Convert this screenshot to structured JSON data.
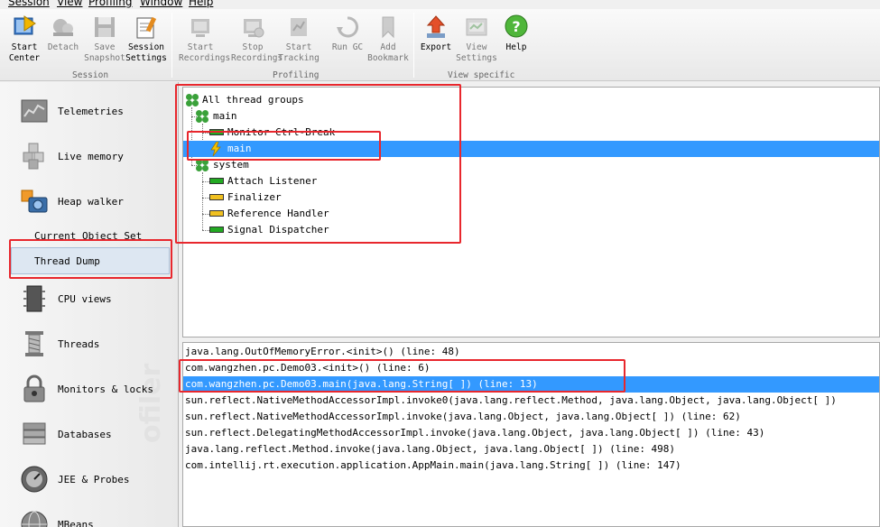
{
  "menu": [
    "Session",
    "View",
    "Profiling",
    "Window",
    "Help"
  ],
  "toolbar": {
    "buttons": [
      {
        "label": "Start\nCenter",
        "icon": "start-center-icon",
        "enabled": true
      },
      {
        "label": "Detach",
        "icon": "detach-icon",
        "enabled": false
      },
      {
        "label": "Save\nSnapshot",
        "icon": "save-snapshot-icon",
        "enabled": false
      },
      {
        "label": "Session\nSettings",
        "icon": "session-settings-icon",
        "enabled": true
      },
      {
        "label": "Start\nRecordings",
        "icon": "start-recordings-icon",
        "enabled": false
      },
      {
        "label": "Stop\nRecordings",
        "icon": "stop-recordings-icon",
        "enabled": false
      },
      {
        "label": "Start\nTracking",
        "icon": "start-tracking-icon",
        "enabled": false
      },
      {
        "label": "Run GC",
        "icon": "run-gc-icon",
        "enabled": false
      },
      {
        "label": "Add\nBookmark",
        "icon": "add-bookmark-icon",
        "enabled": false
      },
      {
        "label": "Export",
        "icon": "export-icon",
        "enabled": true
      },
      {
        "label": "View\nSettings",
        "icon": "view-settings-icon",
        "enabled": false
      },
      {
        "label": "Help",
        "icon": "help-icon",
        "enabled": true
      }
    ],
    "groups": [
      "Session",
      "Profiling",
      "View specific"
    ]
  },
  "sidebar": {
    "items": [
      {
        "label": "Telemetries",
        "icon": "telemetries-icon"
      },
      {
        "label": "Live memory",
        "icon": "live-memory-icon"
      },
      {
        "label": "Heap walker",
        "icon": "heap-walker-icon"
      },
      {
        "label": "CPU views",
        "icon": "cpu-views-icon"
      },
      {
        "label": "Threads",
        "icon": "threads-icon"
      },
      {
        "label": "Monitors & locks",
        "icon": "monitors-locks-icon"
      },
      {
        "label": "Databases",
        "icon": "databases-icon"
      },
      {
        "label": "JEE & Probes",
        "icon": "jee-probes-icon"
      },
      {
        "label": "MBeans",
        "icon": "mbeans-icon"
      }
    ],
    "sub_items": [
      "Current Object Set",
      "Thread Dump"
    ],
    "watermark": "ofiler"
  },
  "thread_tree": {
    "root": "All thread groups",
    "groups": [
      {
        "name": "main",
        "threads": [
          {
            "name": "Monitor Ctrl-Break",
            "state_color": "#22aa22"
          },
          {
            "name": "main",
            "state_color": "#f0c020",
            "selected": true
          }
        ]
      },
      {
        "name": "system",
        "threads": [
          {
            "name": "Attach Listener",
            "state_color": "#22aa22"
          },
          {
            "name": "Finalizer",
            "state_color": "#f0c020"
          },
          {
            "name": "Reference Handler",
            "state_color": "#f0c020"
          },
          {
            "name": "Signal Dispatcher",
            "state_color": "#22aa22"
          }
        ]
      }
    ]
  },
  "stack_trace": [
    "java.lang.OutOfMemoryError.<init>() (line: 48)",
    "com.wangzhen.pc.Demo03.<init>() (line: 6)",
    "com.wangzhen.pc.Demo03.main(java.lang.String[ ]) (line: 13)",
    "sun.reflect.NativeMethodAccessorImpl.invoke0(java.lang.reflect.Method, java.lang.Object, java.lang.Object[ ])",
    "sun.reflect.NativeMethodAccessorImpl.invoke(java.lang.Object, java.lang.Object[ ]) (line: 62)",
    "sun.reflect.DelegatingMethodAccessorImpl.invoke(java.lang.Object, java.lang.Object[ ]) (line: 43)",
    "java.lang.reflect.Method.invoke(java.lang.Object, java.lang.Object[ ]) (line: 498)",
    "com.intellij.rt.execution.application.AppMain.main(java.lang.String[ ]) (line: 147)"
  ],
  "colors": {
    "selection": "#3399ff",
    "annotation": "#e8272d",
    "running": "#22aa22",
    "waiting": "#f0c020"
  }
}
